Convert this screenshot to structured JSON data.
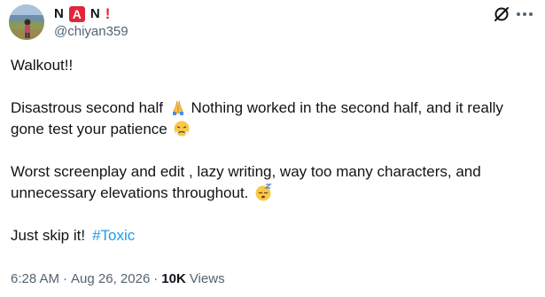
{
  "author": {
    "name_letters": [
      "N",
      "A",
      "N"
    ],
    "name_suffix": "!",
    "handle": "@chiyan359"
  },
  "post": {
    "line1": "Walkout!!",
    "line2a": "Disastrous second half",
    "line2b": " Nothing worked in the second half, and it really gone test your patience",
    "line3": "Worst screenplay and edit , lazy writing, way too many characters, and unnecessary elevations throughout.",
    "line4": "Just skip it!",
    "hashtag": "#Toxic"
  },
  "meta": {
    "time": "6:28 AM",
    "separator": "·",
    "date": "Aug 26, 2026",
    "views_count": "10K",
    "views_label": "Views"
  },
  "icons": {
    "mute": "mute-icon",
    "more": "more-options-icon",
    "folded_hands": "folded-hands-emoji",
    "steam_nose": "face-with-steam-emoji",
    "sleeping": "sleeping-face-emoji"
  },
  "colors": {
    "text": "#0f1419",
    "secondary": "#536471",
    "link": "#1d9bf0",
    "badge_red": "#e0263a"
  }
}
